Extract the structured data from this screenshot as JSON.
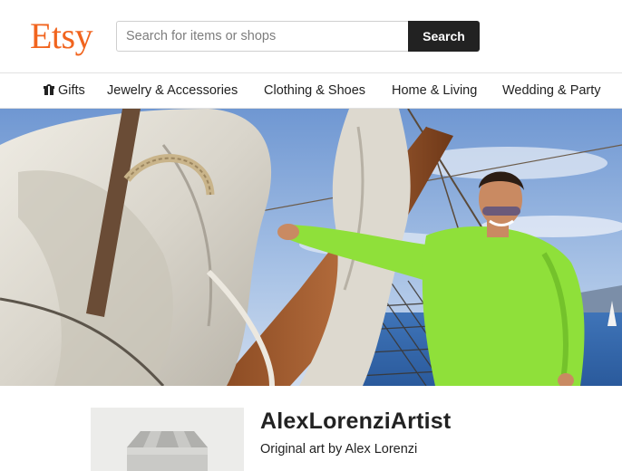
{
  "header": {
    "logo": "Etsy",
    "search_placeholder": "Search for items or shops",
    "search_button": "Search"
  },
  "categories": [
    {
      "label": "Gifts",
      "icon": "gift-icon"
    },
    {
      "label": "Jewelry & Accessories"
    },
    {
      "label": "Clothing & Shoes"
    },
    {
      "label": "Home & Living"
    },
    {
      "label": "Wedding & Party"
    }
  ],
  "shop": {
    "name": "AlexLorenziArtist",
    "tagline": "Original art by Alex Lorenzi"
  },
  "colors": {
    "brand": "#f1641e",
    "search_button_bg": "#222222",
    "shirt": "#8fe03a",
    "sky": "#7fa3d6"
  }
}
